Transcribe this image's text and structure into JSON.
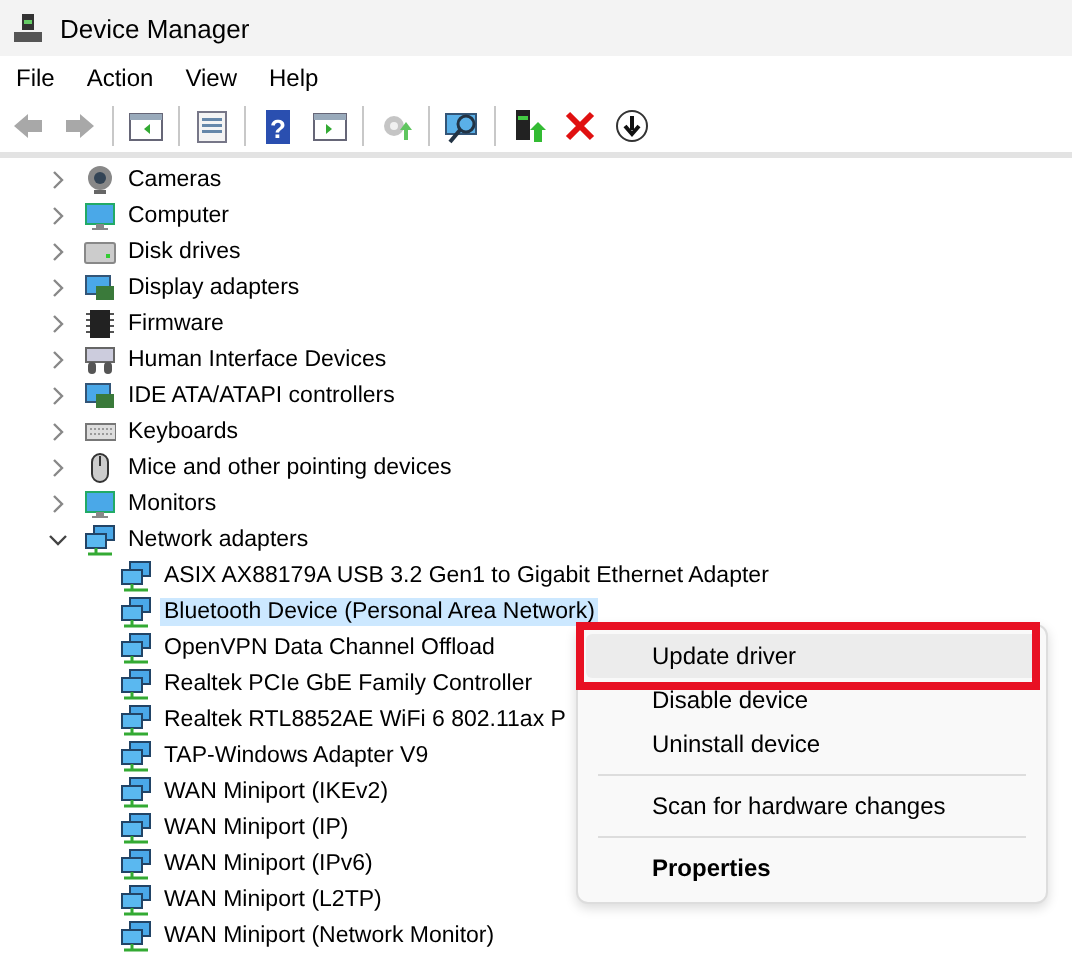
{
  "window": {
    "title": "Device Manager"
  },
  "menu_bar": [
    "File",
    "Action",
    "View",
    "Help"
  ],
  "toolbar": [
    {
      "kind": "back",
      "disabled": true
    },
    {
      "kind": "forward",
      "disabled": true
    },
    {
      "kind": "sep"
    },
    {
      "kind": "panel-left",
      "disabled": false
    },
    {
      "kind": "sep"
    },
    {
      "kind": "properties",
      "disabled": false
    },
    {
      "kind": "sep"
    },
    {
      "kind": "help",
      "disabled": false,
      "glyph": "?"
    },
    {
      "kind": "panel-right",
      "disabled": false
    },
    {
      "kind": "sep"
    },
    {
      "kind": "update",
      "disabled": true
    },
    {
      "kind": "sep"
    },
    {
      "kind": "scan",
      "disabled": false
    },
    {
      "kind": "sep"
    },
    {
      "kind": "enable",
      "disabled": false
    },
    {
      "kind": "uninstall",
      "disabled": false
    },
    {
      "kind": "download",
      "disabled": false
    }
  ],
  "tree": [
    {
      "label": "Cameras",
      "kind": "camera",
      "expanded": false
    },
    {
      "label": "Computer",
      "kind": "monitor",
      "expanded": false
    },
    {
      "label": "Disk drives",
      "kind": "disk",
      "expanded": false
    },
    {
      "label": "Display adapters",
      "kind": "card",
      "expanded": false
    },
    {
      "label": "Firmware",
      "kind": "chip",
      "expanded": false
    },
    {
      "label": "Human Interface Devices",
      "kind": "hid",
      "expanded": false
    },
    {
      "label": "IDE ATA/ATAPI controllers",
      "kind": "card",
      "expanded": false
    },
    {
      "label": "Keyboards",
      "kind": "keyboard",
      "expanded": false
    },
    {
      "label": "Mice and other pointing devices",
      "kind": "mouse",
      "expanded": false
    },
    {
      "label": "Monitors",
      "kind": "monitor",
      "expanded": false
    },
    {
      "label": "Network adapters",
      "kind": "network",
      "expanded": true,
      "children": [
        {
          "label": "ASIX AX88179A USB 3.2 Gen1 to Gigabit Ethernet Adapter",
          "kind": "network",
          "selected": false
        },
        {
          "label": "Bluetooth Device (Personal Area Network)",
          "kind": "network",
          "selected": true
        },
        {
          "label": "OpenVPN Data Channel Offload",
          "kind": "network",
          "selected": false
        },
        {
          "label": "Realtek PCIe GbE Family Controller",
          "kind": "network",
          "selected": false
        },
        {
          "label": "Realtek RTL8852AE WiFi 6 802.11ax P",
          "kind": "network",
          "selected": false
        },
        {
          "label": "TAP-Windows Adapter V9",
          "kind": "network",
          "selected": false
        },
        {
          "label": "WAN Miniport (IKEv2)",
          "kind": "network",
          "selected": false
        },
        {
          "label": "WAN Miniport (IP)",
          "kind": "network",
          "selected": false
        },
        {
          "label": "WAN Miniport (IPv6)",
          "kind": "network",
          "selected": false
        },
        {
          "label": "WAN Miniport (L2TP)",
          "kind": "network",
          "selected": false
        },
        {
          "label": "WAN Miniport (Network Monitor)",
          "kind": "network",
          "selected": false
        }
      ]
    }
  ],
  "context_menu": {
    "items": [
      {
        "kind": "item",
        "label": "Update driver",
        "selected": true,
        "highlighted": true
      },
      {
        "kind": "item",
        "label": "Disable device",
        "selected": false
      },
      {
        "kind": "item",
        "label": "Uninstall device",
        "selected": false
      },
      {
        "kind": "separator"
      },
      {
        "kind": "item",
        "label": "Scan for hardware changes",
        "selected": false
      },
      {
        "kind": "separator"
      },
      {
        "kind": "default",
        "label": "Properties",
        "selected": false
      }
    ]
  }
}
